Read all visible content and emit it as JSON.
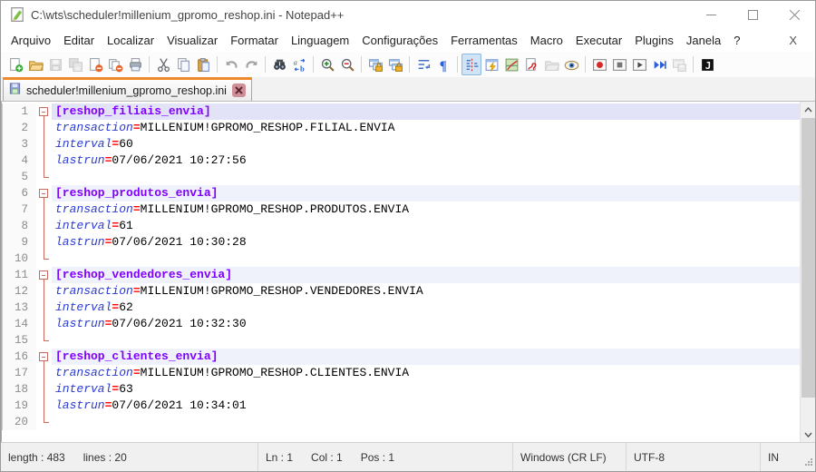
{
  "window": {
    "title": "C:\\wts\\scheduler!millenium_gpromo_reshop.ini - Notepad++"
  },
  "menu": {
    "items": [
      "Arquivo",
      "Editar",
      "Localizar",
      "Visualizar",
      "Formatar",
      "Linguagem",
      "Configurações",
      "Ferramentas",
      "Macro",
      "Executar",
      "Plugins",
      "Janela",
      "?"
    ],
    "close_button": "X"
  },
  "toolbar": {
    "buttons": [
      {
        "name": "new-file",
        "icon": "new"
      },
      {
        "name": "open-file",
        "icon": "open"
      },
      {
        "name": "save-file",
        "icon": "save",
        "disabled": true
      },
      {
        "name": "save-all",
        "icon": "saveall",
        "disabled": true
      },
      {
        "name": "close-file",
        "icon": "close"
      },
      {
        "name": "close-all",
        "icon": "closeall"
      },
      {
        "name": "print",
        "icon": "print"
      },
      {
        "sep": true
      },
      {
        "name": "cut",
        "icon": "cut"
      },
      {
        "name": "copy",
        "icon": "copy"
      },
      {
        "name": "paste",
        "icon": "paste"
      },
      {
        "sep": true
      },
      {
        "name": "undo",
        "icon": "undo"
      },
      {
        "name": "redo",
        "icon": "redo"
      },
      {
        "sep": true
      },
      {
        "name": "find",
        "icon": "find"
      },
      {
        "name": "replace",
        "icon": "replace"
      },
      {
        "sep": true
      },
      {
        "name": "zoom-in",
        "icon": "zoomin"
      },
      {
        "name": "zoom-out",
        "icon": "zoomout"
      },
      {
        "sep": true
      },
      {
        "name": "sync-vertical-scroll",
        "icon": "syncv"
      },
      {
        "name": "sync-horizontal-scroll",
        "icon": "synch"
      },
      {
        "sep": true
      },
      {
        "name": "word-wrap",
        "icon": "wrap"
      },
      {
        "name": "show-all-characters",
        "icon": "pilcrow"
      },
      {
        "sep": true
      },
      {
        "name": "show-indent-guide",
        "icon": "guide",
        "pressed": true
      },
      {
        "name": "function-completion",
        "icon": "funclist"
      },
      {
        "name": "document-map",
        "icon": "docmap"
      },
      {
        "name": "user-defined-dialog",
        "icon": "usercmd"
      },
      {
        "name": "folder-as-workspace",
        "icon": "folderws",
        "disabled": true
      },
      {
        "name": "file-monitoring",
        "icon": "eye"
      },
      {
        "sep": true
      },
      {
        "name": "record-macro",
        "icon": "record"
      },
      {
        "name": "stop-macro",
        "icon": "stop"
      },
      {
        "name": "play-macro",
        "icon": "play"
      },
      {
        "name": "run-macro-multiple-times",
        "icon": "playall"
      },
      {
        "name": "save-recorded-macro",
        "icon": "savemacro",
        "disabled": true
      },
      {
        "sep": true
      },
      {
        "name": "plugin-j",
        "icon": "pluginj"
      }
    ]
  },
  "tab": {
    "label": "scheduler!millenium_gpromo_reshop.ini",
    "saved": true
  },
  "editor": {
    "lines": [
      {
        "num": "1",
        "kind": "section",
        "text": "[reshop_filiais_envia]",
        "fold": "start",
        "current": true
      },
      {
        "num": "2",
        "kind": "kv",
        "key": "transaction",
        "value": "MILLENIUM!GPROMO_RESHOP.FILIAL.ENVIA",
        "fold": "mid"
      },
      {
        "num": "3",
        "kind": "kv",
        "key": "interval",
        "value": "60",
        "fold": "mid"
      },
      {
        "num": "4",
        "kind": "kv",
        "key": "lastrun",
        "value": "07/06/2021 10:27:56",
        "fold": "mid"
      },
      {
        "num": "5",
        "kind": "blank",
        "fold": "end"
      },
      {
        "num": "6",
        "kind": "section",
        "text": "[reshop_produtos_envia]",
        "fold": "start"
      },
      {
        "num": "7",
        "kind": "kv",
        "key": "transaction",
        "value": "MILLENIUM!GPROMO_RESHOP.PRODUTOS.ENVIA",
        "fold": "mid"
      },
      {
        "num": "8",
        "kind": "kv",
        "key": "interval",
        "value": "61",
        "fold": "mid"
      },
      {
        "num": "9",
        "kind": "kv",
        "key": "lastrun",
        "value": "07/06/2021 10:30:28",
        "fold": "mid"
      },
      {
        "num": "10",
        "kind": "blank",
        "fold": "end"
      },
      {
        "num": "11",
        "kind": "section",
        "text": "[reshop_vendedores_envia]",
        "fold": "start"
      },
      {
        "num": "12",
        "kind": "kv",
        "key": "transaction",
        "value": "MILLENIUM!GPROMO_RESHOP.VENDEDORES.ENVIA",
        "fold": "mid"
      },
      {
        "num": "13",
        "kind": "kv",
        "key": "interval",
        "value": "62",
        "fold": "mid"
      },
      {
        "num": "14",
        "kind": "kv",
        "key": "lastrun",
        "value": "07/06/2021 10:32:30",
        "fold": "mid"
      },
      {
        "num": "15",
        "kind": "blank",
        "fold": "end"
      },
      {
        "num": "16",
        "kind": "section",
        "text": "[reshop_clientes_envia]",
        "fold": "start"
      },
      {
        "num": "17",
        "kind": "kv",
        "key": "transaction",
        "value": "MILLENIUM!GPROMO_RESHOP.CLIENTES.ENVIA",
        "fold": "mid"
      },
      {
        "num": "18",
        "kind": "kv",
        "key": "interval",
        "value": "63",
        "fold": "mid"
      },
      {
        "num": "19",
        "kind": "kv",
        "key": "lastrun",
        "value": "07/06/2021 10:34:01",
        "fold": "mid"
      },
      {
        "num": "20",
        "kind": "blank",
        "fold": "end"
      }
    ]
  },
  "statusbar": {
    "doc_fields": [
      "length : 483",
      "lines : 20"
    ],
    "pos_fields": [
      "Ln : 1",
      "Col : 1",
      "Pos : 1"
    ],
    "eol": "Windows (CR LF)",
    "encoding": "UTF-8",
    "mode": "IN"
  },
  "colors": {
    "tab_accent": "#ee8a2c",
    "section_text": "#8000ff",
    "section_bg": "#eff2fa",
    "current_line_bg": "#e3e3f7",
    "key_text": "#2b3bd0",
    "equals_text": "#ff0000",
    "value_text": "#000000",
    "fold_marks": "#cd6a5f"
  }
}
